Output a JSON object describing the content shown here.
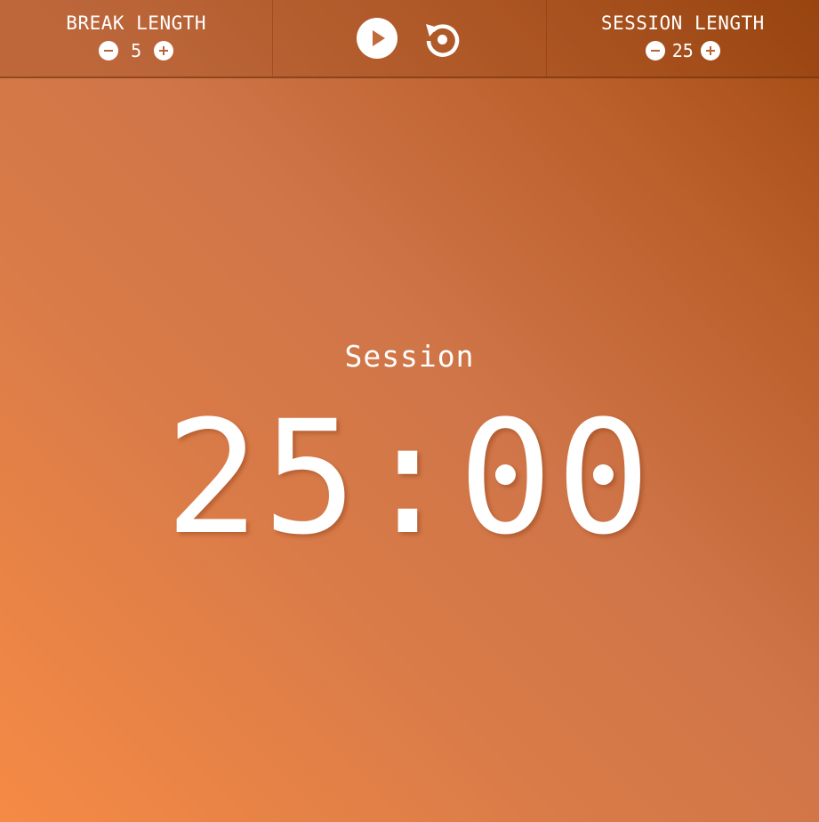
{
  "break": {
    "title": "BREAK LENGTH",
    "value": "5",
    "decrement_icon": "minus-circle-icon",
    "increment_icon": "plus-circle-icon"
  },
  "controls": {
    "play_icon": "play-icon",
    "reset_icon": "reset-icon"
  },
  "session": {
    "title": "SESSION LENGTH",
    "value": "25",
    "decrement_icon": "minus-circle-icon",
    "increment_icon": "plus-circle-icon"
  },
  "timer": {
    "label": "Session",
    "time": "25:00"
  },
  "colors": {
    "gradient_start": "#f58a45",
    "gradient_end": "#a24a12",
    "text": "#ffffff"
  }
}
